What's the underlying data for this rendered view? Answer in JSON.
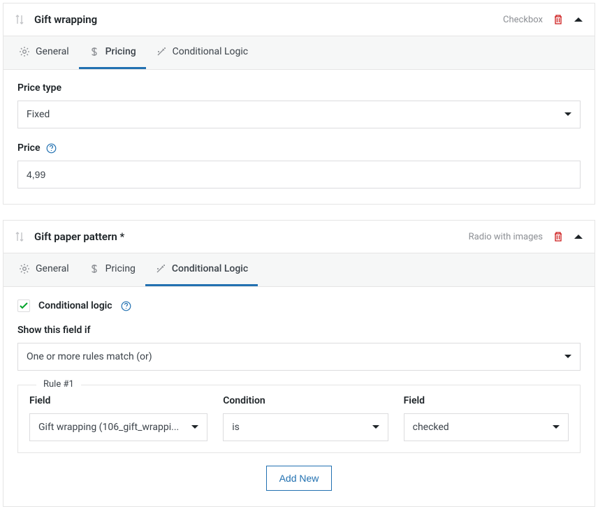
{
  "panel1": {
    "title": "Gift wrapping",
    "field_type": "Checkbox",
    "tabs": {
      "general": "General",
      "pricing": "Pricing",
      "conditional": "Conditional Logic"
    },
    "price_type_label": "Price type",
    "price_type_value": "Fixed",
    "price_label": "Price",
    "price_value": "4,99"
  },
  "panel2": {
    "title": "Gift paper pattern *",
    "field_type": "Radio with images",
    "tabs": {
      "general": "General",
      "pricing": "Pricing",
      "conditional": "Conditional Logic"
    },
    "cond_check_label": "Conditional logic",
    "show_if_label": "Show this field if",
    "show_if_value": "One or more rules match (or)",
    "rule_legend": "Rule #1",
    "rule_field1_label": "Field",
    "rule_field1_value": "Gift wrapping (106_gift_wrappi...",
    "rule_cond_label": "Condition",
    "rule_cond_value": "is",
    "rule_field2_label": "Field",
    "rule_field2_value": "checked",
    "add_new": "Add New"
  }
}
